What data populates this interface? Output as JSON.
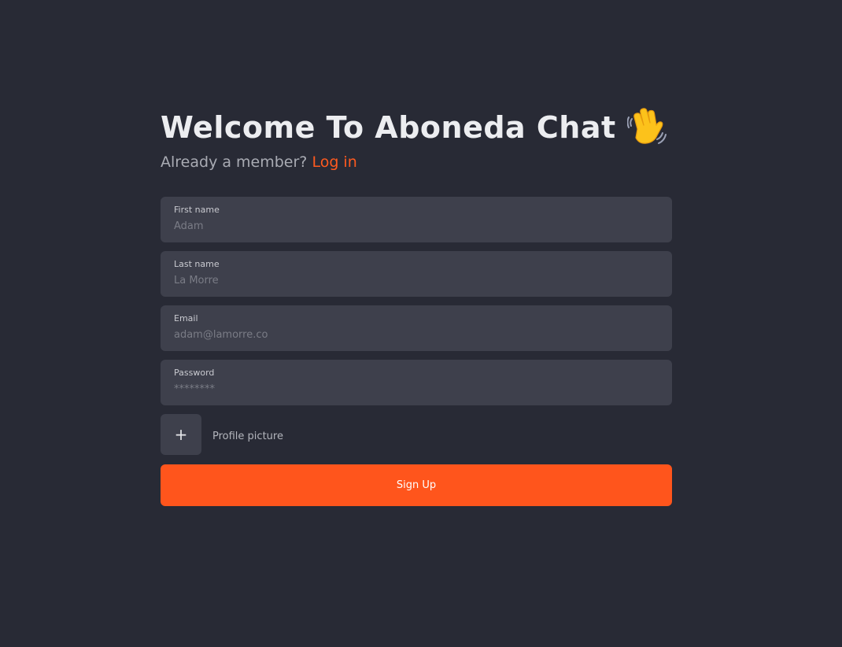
{
  "header": {
    "title": "Welcome To Aboneda Chat",
    "subtitle_text": "Already a member?",
    "login_link": "Log in"
  },
  "fields": {
    "first_name": {
      "label": "First name",
      "placeholder": "Adam"
    },
    "last_name": {
      "label": "Last name",
      "placeholder": "La Morre"
    },
    "email": {
      "label": "Email",
      "placeholder": "adam@lamorre.co"
    },
    "password": {
      "label": "Password",
      "placeholder": "********"
    }
  },
  "profile_picture": {
    "button_glyph": "+",
    "label": "Profile picture"
  },
  "signup_button": {
    "label": "Sign Up"
  },
  "icons": {
    "wave": "waving-hand-icon",
    "add": "plus-icon"
  },
  "colors": {
    "background": "#282a35",
    "field_background": "#3e404c",
    "accent": "#ff551c",
    "title": "#ecedf0"
  }
}
